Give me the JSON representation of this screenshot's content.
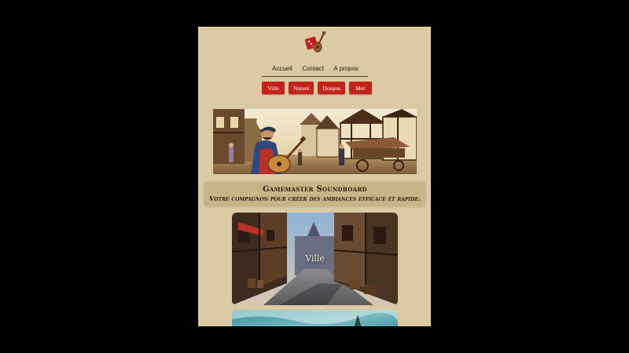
{
  "nav": {
    "items": [
      "Accueil",
      "Contact",
      "A propos"
    ]
  },
  "categories": [
    "Ville",
    "Nature",
    "Donjon",
    "Mer"
  ],
  "header": {
    "title": "Gamemaster Soundboard",
    "subtitle": "Votre compagnon pour créer des ambiances efficace et rapide."
  },
  "cards": {
    "ville": "Ville"
  },
  "colors": {
    "page_bg": "#dccaa4",
    "button": "#c4231b",
    "title_box": "#c9b487"
  },
  "icons": {
    "logo": "dice-and-lute-logo"
  }
}
